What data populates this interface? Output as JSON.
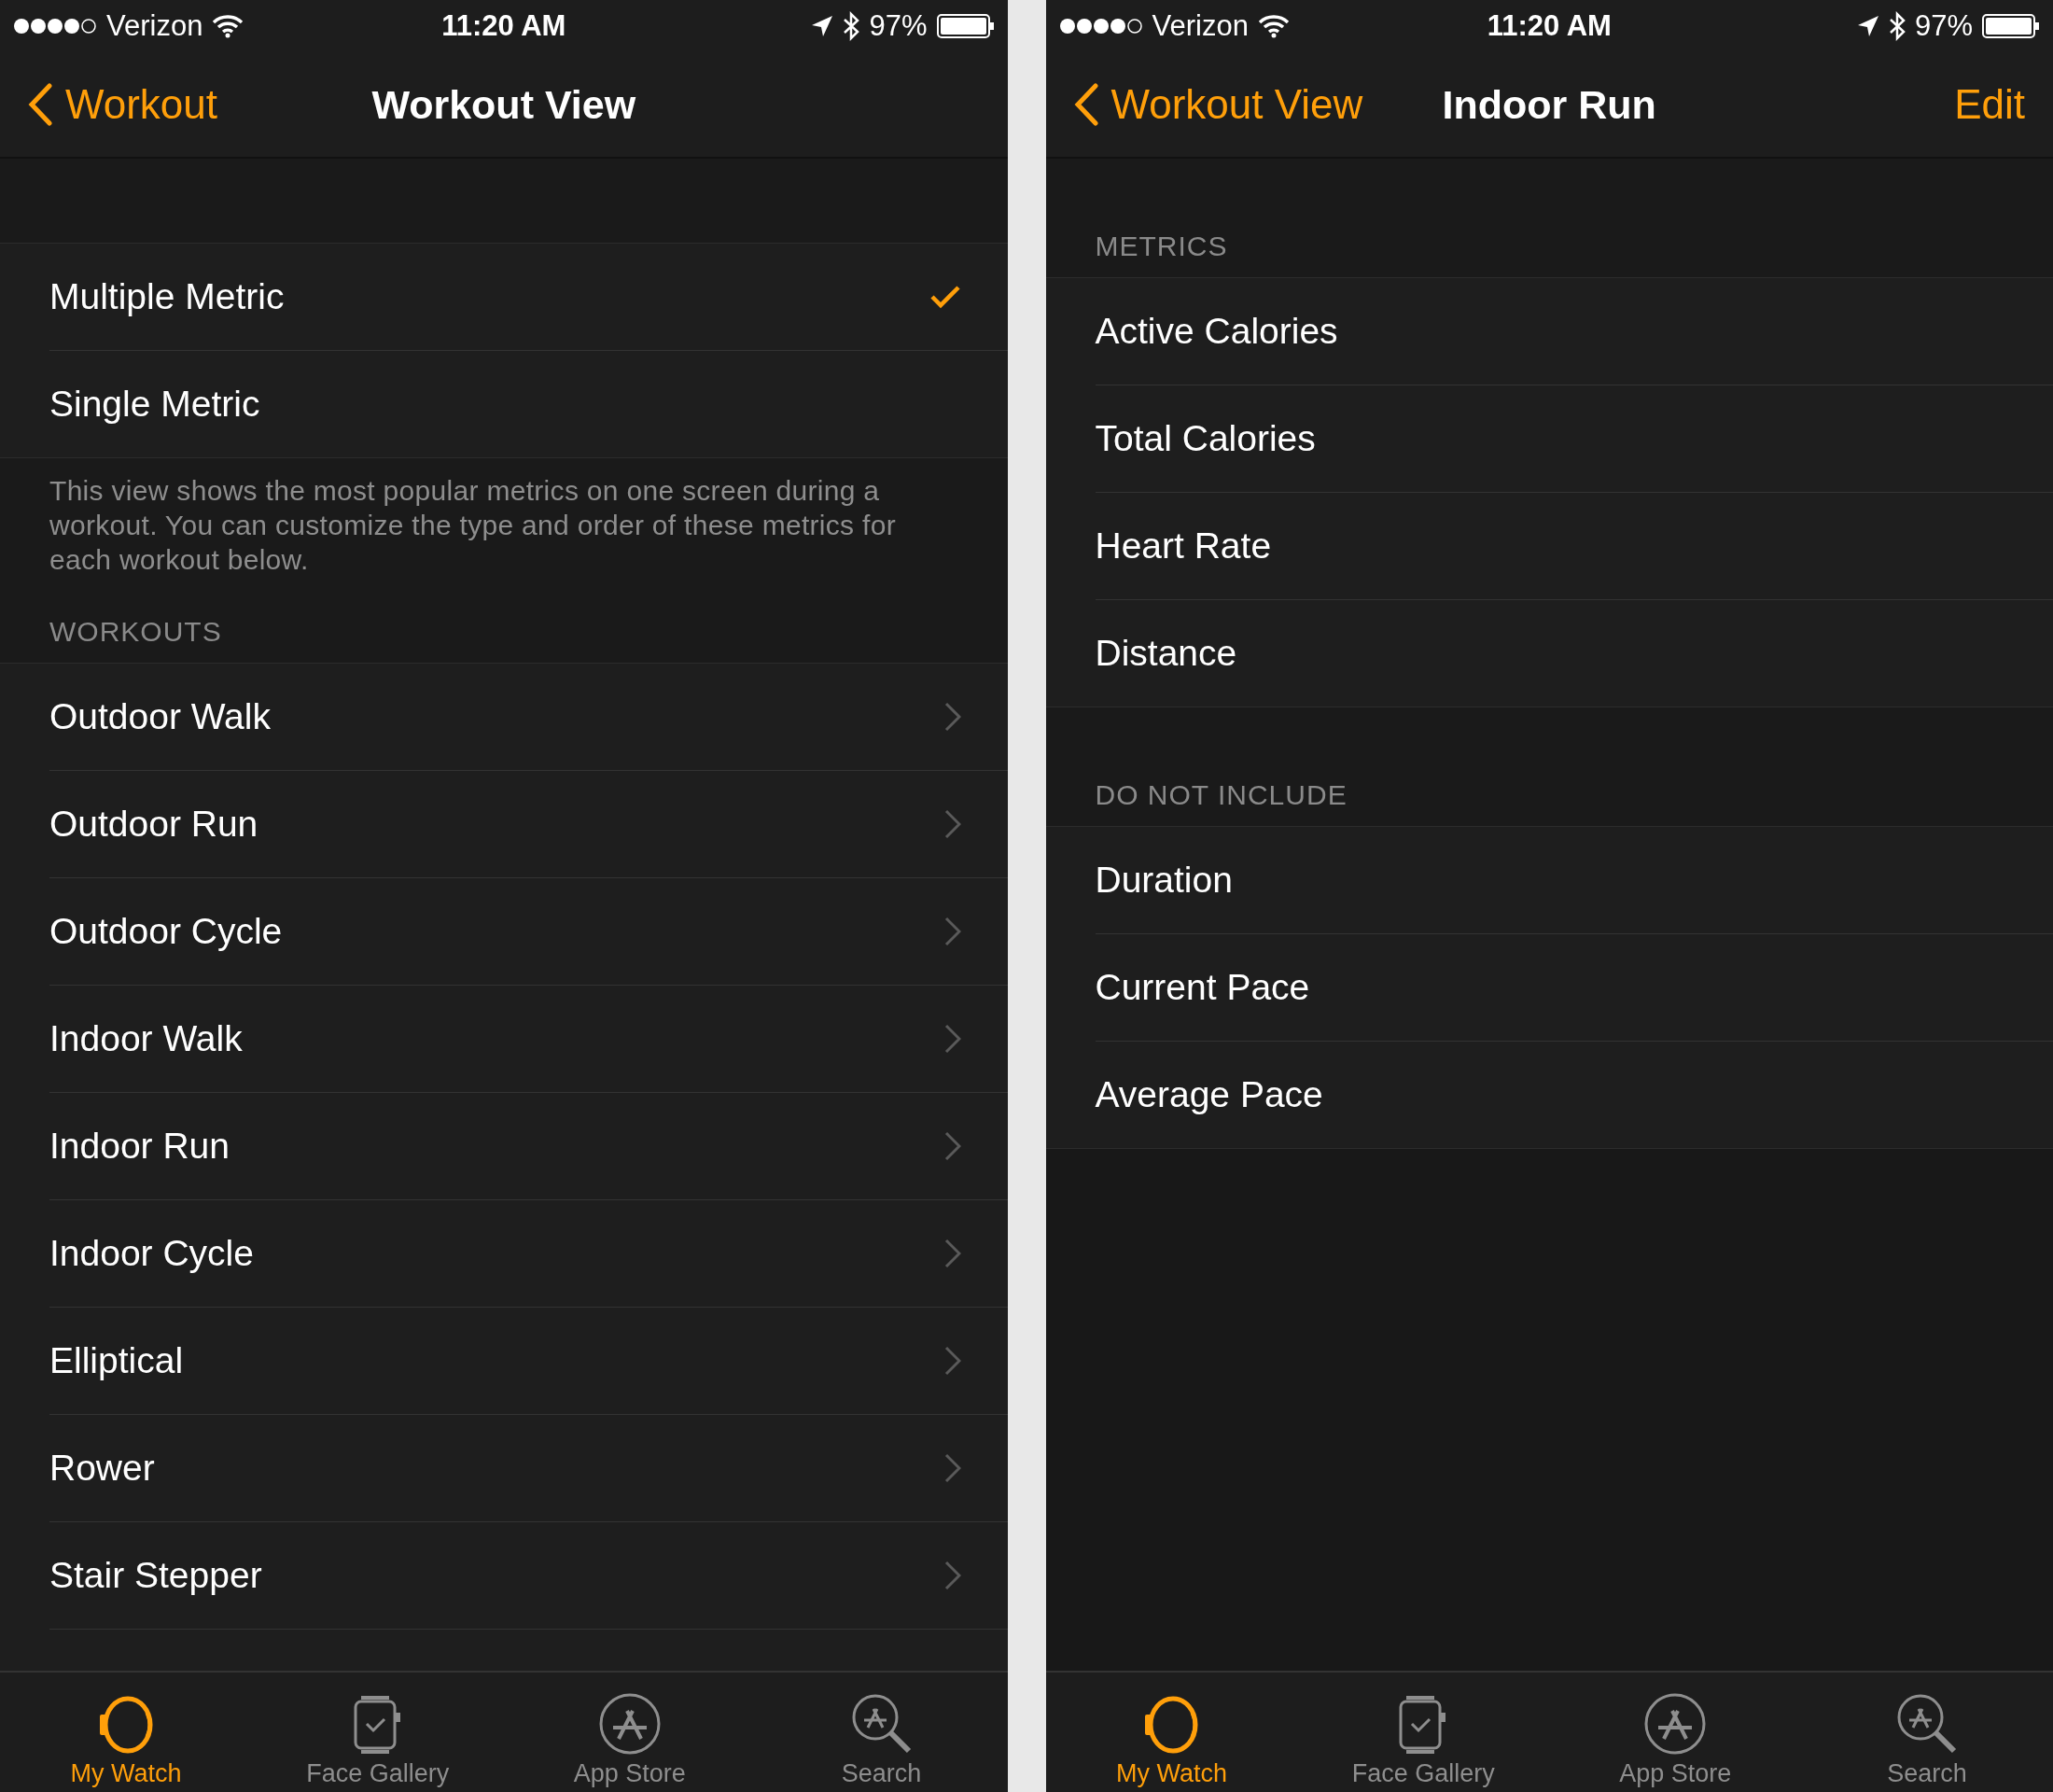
{
  "screens": [
    {
      "status_bar": {
        "carrier": "Verizon",
        "time": "11:20 AM",
        "battery": "97%"
      },
      "nav": {
        "back": "Workout",
        "title": "Workout View"
      },
      "sections": [
        {
          "rows": [
            {
              "label": "Multiple Metric",
              "kind": "check",
              "checked": true
            },
            {
              "label": "Single Metric",
              "kind": "check",
              "checked": false
            }
          ],
          "footer": "This view shows the most popular metrics on one screen during a workout. You can customize the type and order of these metrics for each workout below."
        },
        {
          "header": "WORKOUTS",
          "rows": [
            {
              "label": "Outdoor Walk",
              "kind": "link"
            },
            {
              "label": "Outdoor Run",
              "kind": "link"
            },
            {
              "label": "Outdoor Cycle",
              "kind": "link"
            },
            {
              "label": "Indoor Walk",
              "kind": "link"
            },
            {
              "label": "Indoor Run",
              "kind": "link"
            },
            {
              "label": "Indoor Cycle",
              "kind": "link"
            },
            {
              "label": "Elliptical",
              "kind": "link"
            },
            {
              "label": "Rower",
              "kind": "link"
            },
            {
              "label": "Stair Stepper",
              "kind": "link"
            }
          ]
        }
      ],
      "tabs": [
        {
          "label": "My Watch",
          "kind": "watch",
          "selected": true
        },
        {
          "label": "Face Gallery",
          "kind": "face",
          "selected": false
        },
        {
          "label": "App Store",
          "kind": "store",
          "selected": false
        },
        {
          "label": "Search",
          "kind": "search",
          "selected": false
        }
      ]
    },
    {
      "status_bar": {
        "carrier": "Verizon",
        "time": "11:20 AM",
        "battery": "97%"
      },
      "nav": {
        "back": "Workout View",
        "title": "Indoor Run",
        "action": "Edit"
      },
      "sections": [
        {
          "header": "METRICS",
          "rows": [
            {
              "label": "Active Calories",
              "kind": "plain"
            },
            {
              "label": "Total Calories",
              "kind": "plain"
            },
            {
              "label": "Heart Rate",
              "kind": "plain"
            },
            {
              "label": "Distance",
              "kind": "plain"
            }
          ]
        },
        {
          "header": "DO NOT INCLUDE",
          "rows": [
            {
              "label": "Duration",
              "kind": "plain"
            },
            {
              "label": "Current Pace",
              "kind": "plain"
            },
            {
              "label": "Average Pace",
              "kind": "plain"
            }
          ]
        }
      ],
      "tabs": [
        {
          "label": "My Watch",
          "kind": "watch",
          "selected": true
        },
        {
          "label": "Face Gallery",
          "kind": "face",
          "selected": false
        },
        {
          "label": "App Store",
          "kind": "store",
          "selected": false
        },
        {
          "label": "Search",
          "kind": "search",
          "selected": false
        }
      ]
    }
  ]
}
